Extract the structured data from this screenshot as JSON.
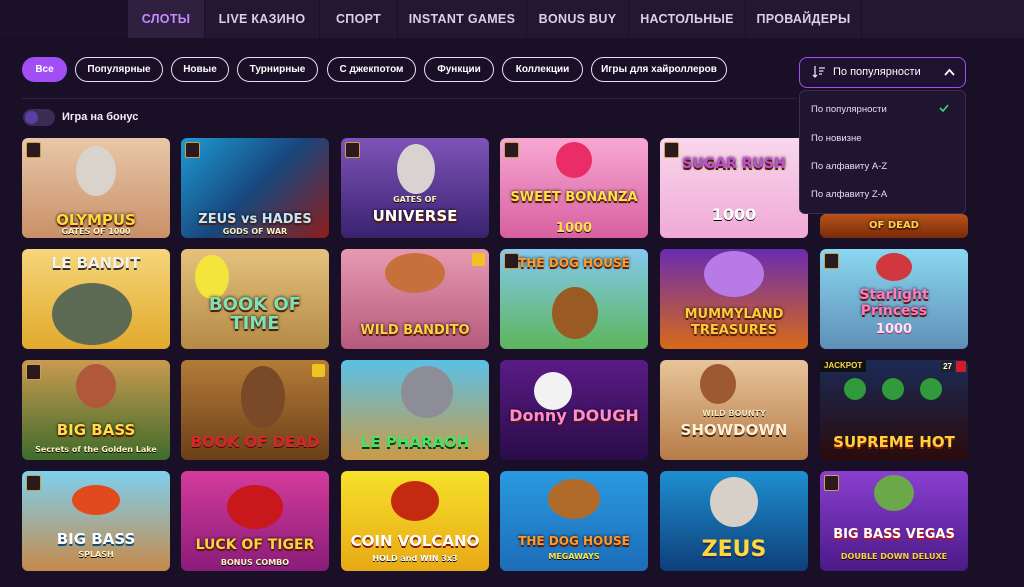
{
  "nav": {
    "tabs": [
      {
        "label": "СЛОТЫ",
        "active": true
      },
      {
        "label": "LIVE КАЗИНО",
        "active": false
      },
      {
        "label": "СПОРТ",
        "active": false
      },
      {
        "label": "INSTANT GAMES",
        "active": false
      },
      {
        "label": "BONUS BUY",
        "active": false
      },
      {
        "label": "НАСТОЛЬНЫЕ",
        "active": false
      },
      {
        "label": "ПРОВАЙДЕРЫ",
        "active": false
      }
    ]
  },
  "filters": {
    "chips": [
      {
        "label": "Все",
        "active": true
      },
      {
        "label": "Популярные",
        "active": false
      },
      {
        "label": "Новые",
        "active": false
      },
      {
        "label": "Турнирные",
        "active": false
      },
      {
        "label": "С джекпотом",
        "active": false
      },
      {
        "label": "Функции",
        "active": false
      },
      {
        "label": "Коллекции",
        "active": false
      },
      {
        "label": "Игры для хайроллеров",
        "active": false
      }
    ],
    "bonus_toggle_label": "Игра на бонус",
    "bonus_toggle_on": false
  },
  "sort": {
    "selected": "По популярности",
    "open": true,
    "options": [
      "По популярности",
      "По новизне",
      "По алфавиту A-Z",
      "По алфавиту Z-A"
    ],
    "accent": "#a24ef5"
  },
  "games": [
    {
      "title": "OLYMPUS",
      "sub": "GATES OF 1000"
    },
    {
      "title": "ZEUS vs HADES",
      "sub": "GODS OF WAR"
    },
    {
      "title": "UNIVERSE",
      "sub": "GATES OF"
    },
    {
      "title": "SWEET BONANZA",
      "sub": "1000"
    },
    {
      "title": "SUGAR RUSH",
      "sub": "1000"
    },
    {
      "title": "OF DEAD",
      "sub": ""
    },
    {
      "title": "LE BANDIT",
      "sub": ""
    },
    {
      "title": "BOOK OF TIME",
      "sub": ""
    },
    {
      "title": "WILD BANDITO",
      "sub": ""
    },
    {
      "title": "THE DOG HOUSE",
      "sub": ""
    },
    {
      "title": "MUMMYLAND TREASURES",
      "sub": ""
    },
    {
      "title": "Starlight Princess",
      "sub": "1000"
    },
    {
      "title": "BIG BASS",
      "sub": "Secrets of the Golden Lake"
    },
    {
      "title": "BOOK OF DEAD",
      "sub": ""
    },
    {
      "title": "LE PHARAOH",
      "sub": ""
    },
    {
      "title": "Donny DOUGH",
      "sub": ""
    },
    {
      "title": "SHOWDOWN",
      "sub": "WILD BOUNTY"
    },
    {
      "title": "SUPREME HOT",
      "sub": "",
      "jackpot": "JACKPOT",
      "num": "27"
    },
    {
      "title": "BIG BASS",
      "sub": "SPLASH"
    },
    {
      "title": "LUCK OF TIGER",
      "sub": "BONUS COMBO"
    },
    {
      "title": "COIN VOLCANO",
      "sub": "HOLD and WIN 3x3"
    },
    {
      "title": "THE DOG HOUSE",
      "sub": "MEGAWAYS"
    },
    {
      "title": "ZEUS",
      "sub": ""
    },
    {
      "title": "BIG BASS VEGAS",
      "sub": "DOUBLE DOWN DELUXE"
    }
  ]
}
